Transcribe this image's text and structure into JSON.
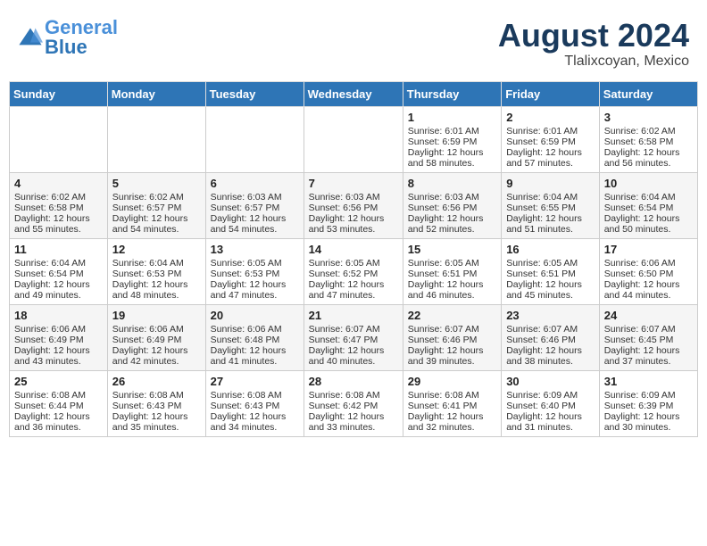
{
  "logo": {
    "text_general": "General",
    "text_blue": "Blue"
  },
  "title": {
    "month_year": "August 2024",
    "location": "Tlalixcoyan, Mexico"
  },
  "headers": [
    "Sunday",
    "Monday",
    "Tuesday",
    "Wednesday",
    "Thursday",
    "Friday",
    "Saturday"
  ],
  "weeks": [
    [
      {
        "day": "",
        "content": ""
      },
      {
        "day": "",
        "content": ""
      },
      {
        "day": "",
        "content": ""
      },
      {
        "day": "",
        "content": ""
      },
      {
        "day": "1",
        "content": "Sunrise: 6:01 AM\nSunset: 6:59 PM\nDaylight: 12 hours\nand 58 minutes."
      },
      {
        "day": "2",
        "content": "Sunrise: 6:01 AM\nSunset: 6:59 PM\nDaylight: 12 hours\nand 57 minutes."
      },
      {
        "day": "3",
        "content": "Sunrise: 6:02 AM\nSunset: 6:58 PM\nDaylight: 12 hours\nand 56 minutes."
      }
    ],
    [
      {
        "day": "4",
        "content": "Sunrise: 6:02 AM\nSunset: 6:58 PM\nDaylight: 12 hours\nand 55 minutes."
      },
      {
        "day": "5",
        "content": "Sunrise: 6:02 AM\nSunset: 6:57 PM\nDaylight: 12 hours\nand 54 minutes."
      },
      {
        "day": "6",
        "content": "Sunrise: 6:03 AM\nSunset: 6:57 PM\nDaylight: 12 hours\nand 54 minutes."
      },
      {
        "day": "7",
        "content": "Sunrise: 6:03 AM\nSunset: 6:56 PM\nDaylight: 12 hours\nand 53 minutes."
      },
      {
        "day": "8",
        "content": "Sunrise: 6:03 AM\nSunset: 6:56 PM\nDaylight: 12 hours\nand 52 minutes."
      },
      {
        "day": "9",
        "content": "Sunrise: 6:04 AM\nSunset: 6:55 PM\nDaylight: 12 hours\nand 51 minutes."
      },
      {
        "day": "10",
        "content": "Sunrise: 6:04 AM\nSunset: 6:54 PM\nDaylight: 12 hours\nand 50 minutes."
      }
    ],
    [
      {
        "day": "11",
        "content": "Sunrise: 6:04 AM\nSunset: 6:54 PM\nDaylight: 12 hours\nand 49 minutes."
      },
      {
        "day": "12",
        "content": "Sunrise: 6:04 AM\nSunset: 6:53 PM\nDaylight: 12 hours\nand 48 minutes."
      },
      {
        "day": "13",
        "content": "Sunrise: 6:05 AM\nSunset: 6:53 PM\nDaylight: 12 hours\nand 47 minutes."
      },
      {
        "day": "14",
        "content": "Sunrise: 6:05 AM\nSunset: 6:52 PM\nDaylight: 12 hours\nand 47 minutes."
      },
      {
        "day": "15",
        "content": "Sunrise: 6:05 AM\nSunset: 6:51 PM\nDaylight: 12 hours\nand 46 minutes."
      },
      {
        "day": "16",
        "content": "Sunrise: 6:05 AM\nSunset: 6:51 PM\nDaylight: 12 hours\nand 45 minutes."
      },
      {
        "day": "17",
        "content": "Sunrise: 6:06 AM\nSunset: 6:50 PM\nDaylight: 12 hours\nand 44 minutes."
      }
    ],
    [
      {
        "day": "18",
        "content": "Sunrise: 6:06 AM\nSunset: 6:49 PM\nDaylight: 12 hours\nand 43 minutes."
      },
      {
        "day": "19",
        "content": "Sunrise: 6:06 AM\nSunset: 6:49 PM\nDaylight: 12 hours\nand 42 minutes."
      },
      {
        "day": "20",
        "content": "Sunrise: 6:06 AM\nSunset: 6:48 PM\nDaylight: 12 hours\nand 41 minutes."
      },
      {
        "day": "21",
        "content": "Sunrise: 6:07 AM\nSunset: 6:47 PM\nDaylight: 12 hours\nand 40 minutes."
      },
      {
        "day": "22",
        "content": "Sunrise: 6:07 AM\nSunset: 6:46 PM\nDaylight: 12 hours\nand 39 minutes."
      },
      {
        "day": "23",
        "content": "Sunrise: 6:07 AM\nSunset: 6:46 PM\nDaylight: 12 hours\nand 38 minutes."
      },
      {
        "day": "24",
        "content": "Sunrise: 6:07 AM\nSunset: 6:45 PM\nDaylight: 12 hours\nand 37 minutes."
      }
    ],
    [
      {
        "day": "25",
        "content": "Sunrise: 6:08 AM\nSunset: 6:44 PM\nDaylight: 12 hours\nand 36 minutes."
      },
      {
        "day": "26",
        "content": "Sunrise: 6:08 AM\nSunset: 6:43 PM\nDaylight: 12 hours\nand 35 minutes."
      },
      {
        "day": "27",
        "content": "Sunrise: 6:08 AM\nSunset: 6:43 PM\nDaylight: 12 hours\nand 34 minutes."
      },
      {
        "day": "28",
        "content": "Sunrise: 6:08 AM\nSunset: 6:42 PM\nDaylight: 12 hours\nand 33 minutes."
      },
      {
        "day": "29",
        "content": "Sunrise: 6:08 AM\nSunset: 6:41 PM\nDaylight: 12 hours\nand 32 minutes."
      },
      {
        "day": "30",
        "content": "Sunrise: 6:09 AM\nSunset: 6:40 PM\nDaylight: 12 hours\nand 31 minutes."
      },
      {
        "day": "31",
        "content": "Sunrise: 6:09 AM\nSunset: 6:39 PM\nDaylight: 12 hours\nand 30 minutes."
      }
    ]
  ]
}
